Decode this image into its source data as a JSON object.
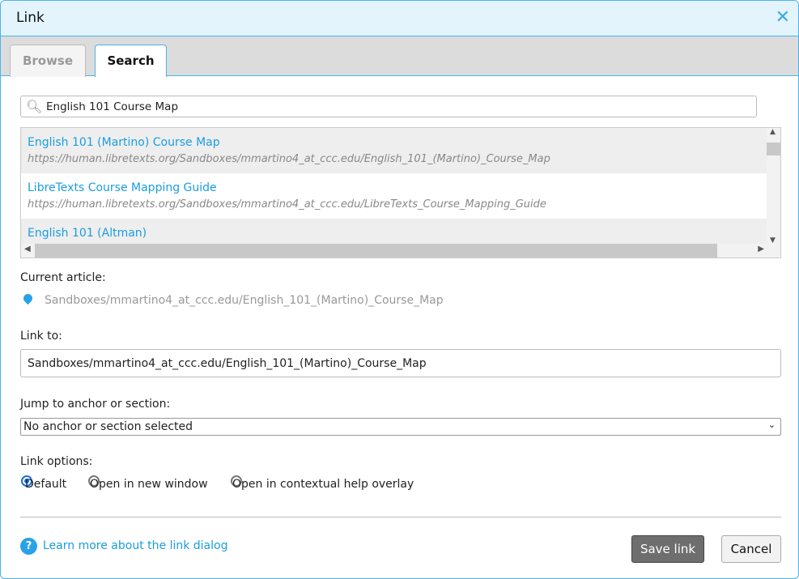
{
  "dialog": {
    "title": "Link",
    "close_icon": "close-icon"
  },
  "tabs": [
    {
      "label": "Browse"
    },
    {
      "label": "Search",
      "active": true
    }
  ],
  "search": {
    "value": "English 101 Course Map"
  },
  "results": [
    {
      "title": "English 101 (Martino) Course Map",
      "url": "https://human.libretexts.org/Sandboxes/mmartino4_at_ccc.edu/English_101_(Martino)_Course_Map"
    },
    {
      "title": "LibreTexts Course Mapping Guide",
      "url": "https://human.libretexts.org/Sandboxes/mmartino4_at_ccc.edu/LibreTexts_Course_Mapping_Guide"
    },
    {
      "title": "English 101 (Altman)"
    }
  ],
  "current": {
    "label": "Current article:",
    "path": "Sandboxes/mmartino4_at_ccc.edu/English_101_(Martino)_Course_Map"
  },
  "link_to": {
    "label": "Link to:",
    "value": "Sandboxes/mmartino4_at_ccc.edu/English_101_(Martino)_Course_Map"
  },
  "anchor": {
    "label": "Jump to anchor or section:",
    "selected": "No anchor or section selected"
  },
  "options": {
    "label": "Link options:",
    "items": [
      "Default",
      "Open in new window",
      "Open in contextual help overlay"
    ],
    "selected": "Default"
  },
  "footer": {
    "help_link": "Learn more about the link dialog",
    "save": "Save link",
    "cancel": "Cancel"
  }
}
